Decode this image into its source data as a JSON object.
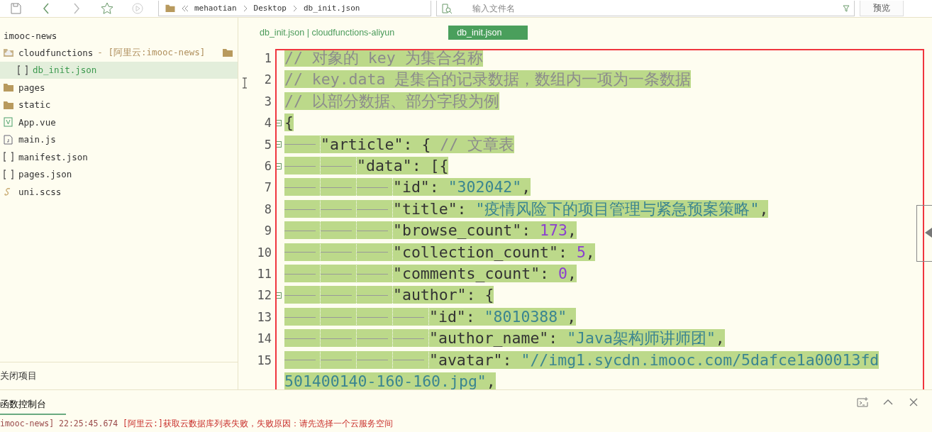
{
  "toolbar": {
    "breadcrumb": [
      "mehaotian",
      "Desktop",
      "db_init.json"
    ],
    "search": {
      "placeholder": "输入文件名"
    },
    "preview_button": "预览"
  },
  "sidebar": {
    "project": "imooc-news",
    "items": [
      {
        "kind": "cloud-folder",
        "label": "cloudfunctions",
        "tag": "- [阿里云:imooc-news]",
        "selected": false,
        "children": [
          {
            "kind": "json",
            "label": "db_init.json",
            "selected": true
          }
        ]
      },
      {
        "kind": "folder",
        "label": "pages",
        "selected": false
      },
      {
        "kind": "folder",
        "label": "static",
        "selected": false
      },
      {
        "kind": "vue",
        "label": "App.vue",
        "selected": false
      },
      {
        "kind": "js",
        "label": "main.js",
        "selected": false
      },
      {
        "kind": "json",
        "label": "manifest.json",
        "selected": false
      },
      {
        "kind": "json",
        "label": "pages.json",
        "selected": false
      },
      {
        "kind": "scss",
        "label": "uni.scss",
        "selected": false
      }
    ],
    "footer": "关闭项目"
  },
  "editor": {
    "tabs": [
      {
        "label": "db_init.json | cloudfunctions-aliyun",
        "selected": false
      },
      {
        "label": "db_init.json",
        "selected": true
      }
    ],
    "lines": [
      {
        "number": "1",
        "fold": false,
        "tokens": [
          {
            "kind": "comment",
            "text": "// 对象的 key 为集合名称"
          }
        ]
      },
      {
        "number": "2",
        "fold": false,
        "tokens": [
          {
            "kind": "comment",
            "text": "// key.data 是集合的记录数据，数组内一项为一条数据"
          }
        ]
      },
      {
        "number": "3",
        "fold": false,
        "tokens": [
          {
            "kind": "comment",
            "text": "// 以部分数据、部分字段为例"
          }
        ]
      },
      {
        "number": "4",
        "fold": true,
        "tokens": [
          {
            "kind": "punct",
            "text": "{"
          }
        ]
      },
      {
        "number": "5",
        "fold": true,
        "tokens": [
          {
            "kind": "key",
            "text": "\t\"article\""
          },
          {
            "kind": "punct",
            "text": ": { "
          },
          {
            "kind": "comment",
            "text": "// 文章表"
          }
        ]
      },
      {
        "number": "6",
        "fold": true,
        "tokens": [
          {
            "kind": "key",
            "text": "\t\t\"data\""
          },
          {
            "kind": "punct",
            "text": ": [{"
          }
        ]
      },
      {
        "number": "7",
        "fold": false,
        "tokens": [
          {
            "kind": "key",
            "text": "\t\t\t\"id\""
          },
          {
            "kind": "punct",
            "text": ": "
          },
          {
            "kind": "string",
            "text": "\"302042\""
          },
          {
            "kind": "punct",
            "text": ","
          }
        ]
      },
      {
        "number": "8",
        "fold": false,
        "tokens": [
          {
            "kind": "key",
            "text": "\t\t\t\"title\""
          },
          {
            "kind": "punct",
            "text": ": "
          },
          {
            "kind": "string",
            "text": "\"疫情风险下的项目管理与紧急预案策略\""
          },
          {
            "kind": "punct",
            "text": ","
          }
        ]
      },
      {
        "number": "9",
        "fold": false,
        "tokens": [
          {
            "kind": "key",
            "text": "\t\t\t\"browse_count\""
          },
          {
            "kind": "punct",
            "text": ": "
          },
          {
            "kind": "number",
            "text": "173"
          },
          {
            "kind": "punct",
            "text": ","
          }
        ]
      },
      {
        "number": "10",
        "fold": false,
        "tokens": [
          {
            "kind": "key",
            "text": "\t\t\t\"collection_count\""
          },
          {
            "kind": "punct",
            "text": ": "
          },
          {
            "kind": "number",
            "text": "5"
          },
          {
            "kind": "punct",
            "text": ","
          }
        ]
      },
      {
        "number": "11",
        "fold": false,
        "tokens": [
          {
            "kind": "key",
            "text": "\t\t\t\"comments_count\""
          },
          {
            "kind": "punct",
            "text": ": "
          },
          {
            "kind": "number",
            "text": "0"
          },
          {
            "kind": "punct",
            "text": ","
          }
        ]
      },
      {
        "number": "12",
        "fold": true,
        "tokens": [
          {
            "kind": "key",
            "text": "\t\t\t\"author\""
          },
          {
            "kind": "punct",
            "text": ": {"
          }
        ]
      },
      {
        "number": "13",
        "fold": false,
        "tokens": [
          {
            "kind": "key",
            "text": "\t\t\t\t\"id\""
          },
          {
            "kind": "punct",
            "text": ": "
          },
          {
            "kind": "string",
            "text": "\"8010388\""
          },
          {
            "kind": "punct",
            "text": ","
          }
        ]
      },
      {
        "number": "14",
        "fold": false,
        "tokens": [
          {
            "kind": "key",
            "text": "\t\t\t\t\"author_name\""
          },
          {
            "kind": "punct",
            "text": ": "
          },
          {
            "kind": "string",
            "text": "\"Java架构师讲师团\""
          },
          {
            "kind": "punct",
            "text": ","
          }
        ]
      },
      {
        "number": "15",
        "fold": false,
        "tokens": [
          {
            "kind": "key",
            "text": "\t\t\t\t\"avatar\""
          },
          {
            "kind": "punct",
            "text": ": "
          },
          {
            "kind": "string",
            "text": "\"//img1.sycdn.imooc.com/5dafce1a00013fd501400140-160-160.jpg\""
          },
          {
            "kind": "punct",
            "text": ","
          }
        ]
      }
    ]
  },
  "console": {
    "tab": "函数控制台",
    "log": [
      {
        "kind": "source",
        "text": "imooc-news] 22:25:45.674"
      },
      {
        "kind": "error",
        "text": "[阿里云:]获取云数据库列表失败，失败原因：请先选择一个云服务空间"
      }
    ]
  }
}
